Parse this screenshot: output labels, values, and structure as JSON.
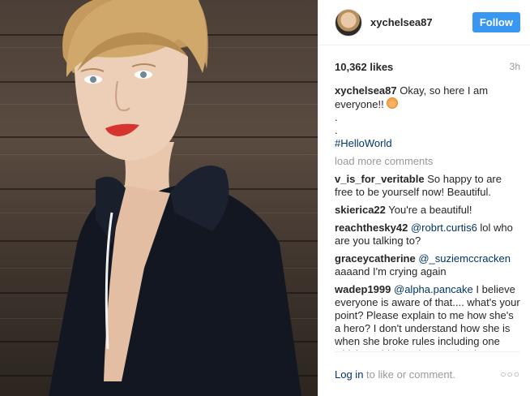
{
  "post": {
    "username": "xychelsea87",
    "follow_label": "Follow",
    "likes": "10,362 likes",
    "time": "3h"
  },
  "caption": {
    "user": "xychelsea87",
    "text": "Okay, so here I am everyone!!",
    "dot1": ".",
    "dot2": ".",
    "hashtag": "#HelloWorld"
  },
  "load_more": "load more comments",
  "comments": [
    {
      "user": "v_is_for_veritable",
      "mention": "",
      "text": "So happy to are free to be yourself now! Beautiful."
    },
    {
      "user": "skierica22",
      "mention": "",
      "text": "You're a beautiful!"
    },
    {
      "user": "reachthesky42",
      "mention": "@robrt.curtis6",
      "text": "lol who are you talking to?"
    },
    {
      "user": "graceycatherine",
      "mention": "@_suziemccracken",
      "text": "aaaand I'm crying again"
    },
    {
      "user": "wadep1999",
      "mention": "@alpha.pancake",
      "text": "I believe everyone is aware of that.... what's your point? Please explain to me how she's a hero? I don't understand how she is when she broke rules including one which could have been a death sentence"
    }
  ],
  "footer": {
    "login": "Log in",
    "login_rest": "to like or comment.",
    "more": "○○○"
  },
  "icons": {
    "emoji": "smiling-face-emoji",
    "more": "more-options-icon"
  },
  "colors": {
    "follow_bg": "#3897f0",
    "link": "#003569",
    "muted": "#999999"
  }
}
